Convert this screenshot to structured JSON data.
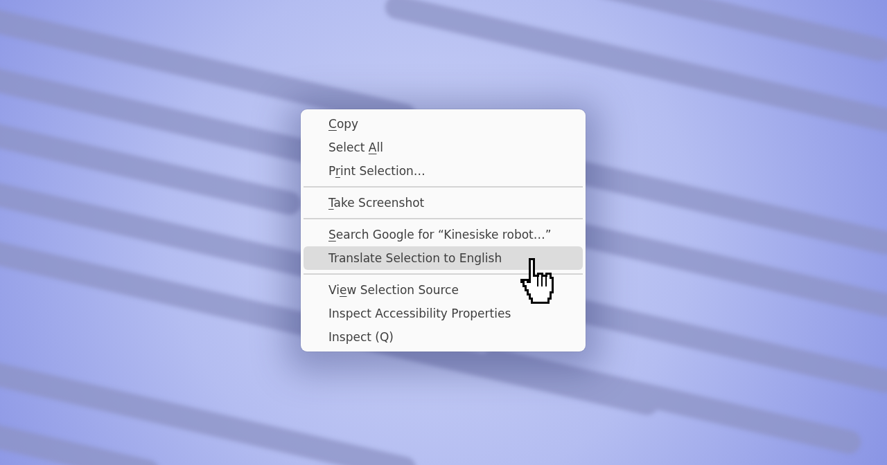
{
  "context_menu": {
    "items": [
      {
        "kind": "item",
        "key": "C",
        "after": "opy",
        "selected": false
      },
      {
        "kind": "item",
        "before": "Select ",
        "key": "A",
        "after": "ll",
        "selected": false
      },
      {
        "kind": "item",
        "before": "P",
        "key": "r",
        "after": "int Selection…",
        "selected": false
      },
      {
        "kind": "separator"
      },
      {
        "kind": "item",
        "key": "T",
        "after": "ake Screenshot",
        "selected": false
      },
      {
        "kind": "separator"
      },
      {
        "kind": "item",
        "key": "S",
        "after": "earch Google for “Kinesiske robot…”",
        "selected": false
      },
      {
        "kind": "item",
        "before": "Translate Selection to English",
        "selected": true
      },
      {
        "kind": "separator"
      },
      {
        "kind": "item",
        "before": "Vi",
        "key": "e",
        "after": "w Selection Source",
        "selected": false
      },
      {
        "kind": "item",
        "before": "Inspect Accessibility Properties",
        "selected": false
      },
      {
        "kind": "item",
        "before": "Inspect (Q)",
        "selected": false
      }
    ]
  }
}
